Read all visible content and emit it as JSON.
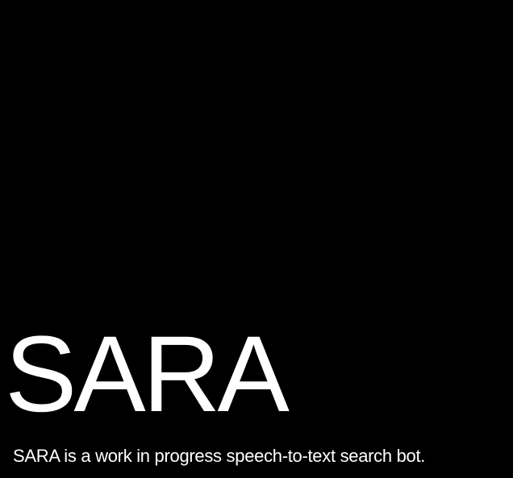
{
  "hero": {
    "title": "SARA",
    "tagline": "SARA is a work in progress speech-to-text search bot."
  },
  "colors": {
    "background": "#000000",
    "text": "#ffffff"
  }
}
